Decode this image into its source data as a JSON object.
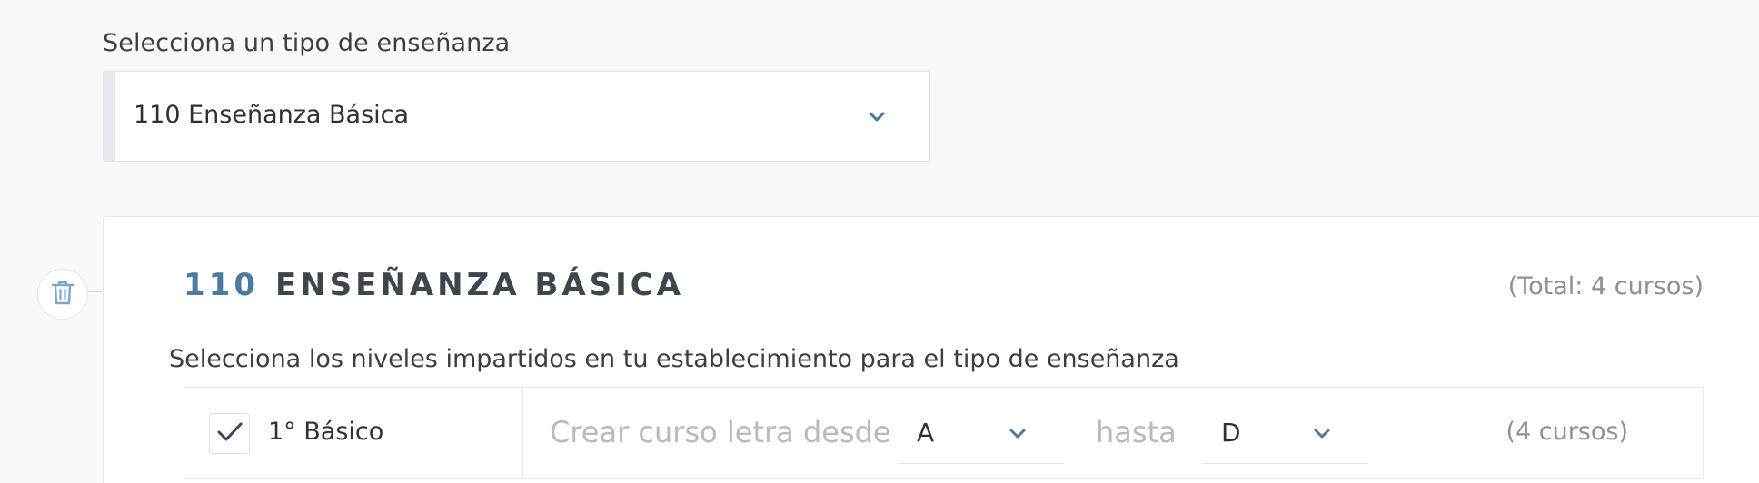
{
  "type_select": {
    "label": "Selecciona un tipo de enseñanza",
    "selected": "110 Enseñanza Básica"
  },
  "section": {
    "code": "110",
    "title": "ENSEÑANZA BÁSICA",
    "total": "(Total: 4 cursos)",
    "instruction": "Selecciona los niveles impartidos en tu establecimiento para el tipo de enseñanza",
    "delete_icon": "trash-icon"
  },
  "levels": [
    {
      "checked": true,
      "label": "1° Básico",
      "create_label": "Crear curso letra desde",
      "from_letter": "A",
      "to_label": "hasta",
      "to_letter": "D",
      "count": "(4 cursos)"
    }
  ],
  "colors": {
    "accent_blue": "#4a7aa0",
    "chevron": "#4a7aa0",
    "muted_text": "#8c9197",
    "placeholder_text": "#b6bbc1"
  }
}
